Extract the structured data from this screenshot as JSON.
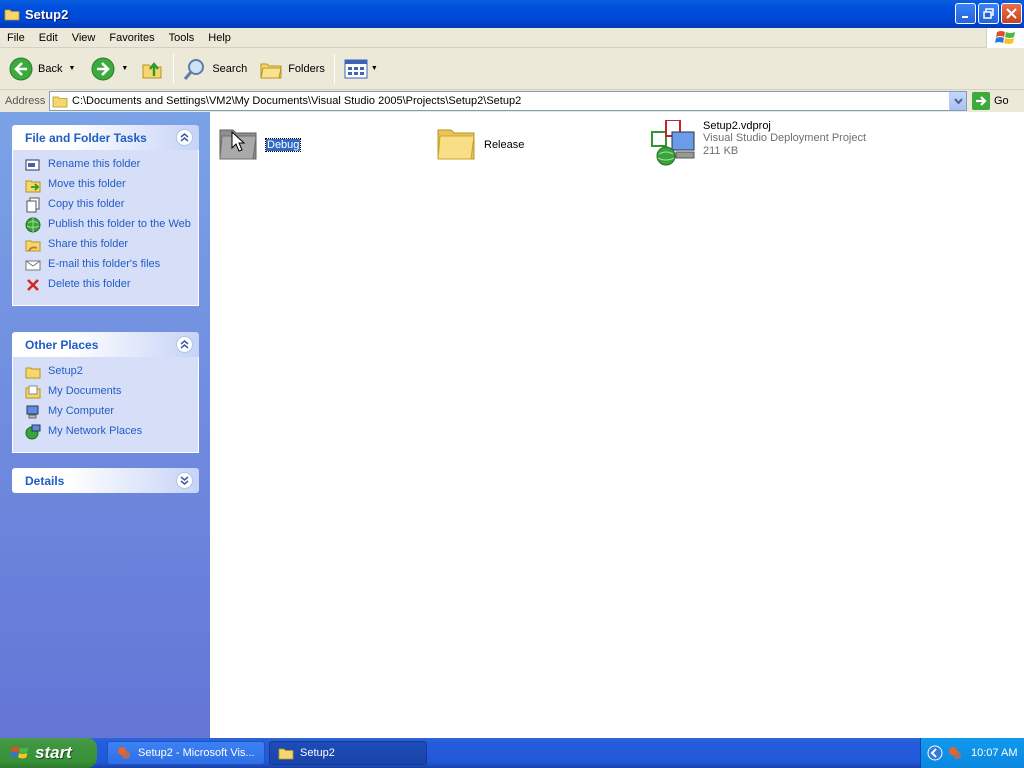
{
  "window": {
    "title": "Setup2",
    "icon": "folder-icon"
  },
  "menu": [
    "File",
    "Edit",
    "View",
    "Favorites",
    "Tools",
    "Help"
  ],
  "toolbar": {
    "back_label": "Back",
    "search_label": "Search",
    "folders_label": "Folders"
  },
  "address": {
    "label": "Address",
    "path": "C:\\Documents and Settings\\VM2\\My Documents\\Visual Studio 2005\\Projects\\Setup2\\Setup2",
    "go_label": "Go"
  },
  "tasks_panel": {
    "title": "File and Folder Tasks",
    "items": [
      {
        "label": "Rename this folder",
        "icon": "rename-icon"
      },
      {
        "label": "Move this folder",
        "icon": "move-icon"
      },
      {
        "label": "Copy this folder",
        "icon": "copy-icon"
      },
      {
        "label": "Publish this folder to the Web",
        "icon": "publish-web-icon"
      },
      {
        "label": "Share this folder",
        "icon": "share-icon"
      },
      {
        "label": "E-mail this folder's files",
        "icon": "email-icon"
      },
      {
        "label": "Delete this folder",
        "icon": "delete-icon"
      }
    ]
  },
  "places_panel": {
    "title": "Other Places",
    "items": [
      {
        "label": "Setup2",
        "icon": "folder-icon"
      },
      {
        "label": "My Documents",
        "icon": "my-documents-icon"
      },
      {
        "label": "My Computer",
        "icon": "my-computer-icon"
      },
      {
        "label": "My Network Places",
        "icon": "network-places-icon"
      }
    ]
  },
  "details_panel": {
    "title": "Details"
  },
  "files": [
    {
      "name": "Debug",
      "type": "folder",
      "selected": true
    },
    {
      "name": "Release",
      "type": "folder",
      "selected": false
    },
    {
      "name": "Setup2.vdproj",
      "type": "file",
      "description": "Visual Studio Deployment Project",
      "size": "211 KB"
    }
  ],
  "taskbar": {
    "start_label": "start",
    "buttons": [
      {
        "label": "Setup2 - Microsoft Vis...",
        "active": false
      },
      {
        "label": "Setup2",
        "active": true
      }
    ],
    "clock": "10:07 AM"
  },
  "colors": {
    "titlebar": "#0050DE",
    "taskpane": "#7BA2E7",
    "link": "#215DC6",
    "selection": "#316AC5"
  }
}
